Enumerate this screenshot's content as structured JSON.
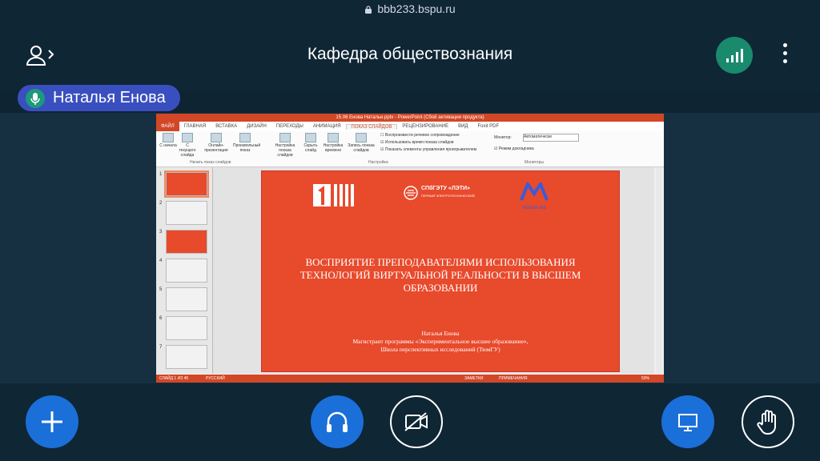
{
  "browser": {
    "url": "bbb233.bspu.ru"
  },
  "header": {
    "title": "Кафедра обществознания"
  },
  "talker": {
    "name": "Наталья Енова"
  },
  "ppt": {
    "window_title": "15.06 Енова Натальи.pptx - PowerPoint (Сбой активации продукта)",
    "tabs": [
      "ФАЙЛ",
      "ГЛАВНАЯ",
      "ВСТАВКА",
      "ДИЗАЙН",
      "ПЕРЕХОДЫ",
      "АНИМАЦИЯ",
      "ПОКАЗ СЛАЙДОВ",
      "РЕЦЕНЗИРОВАНИЕ",
      "ВИД",
      "Foxit PDF"
    ],
    "ribbon": {
      "b1": "С начала",
      "b2": "С текущего слайда",
      "b3": "Онлайн-презентация",
      "b4": "Произвольный показ",
      "b5": "Настройка показа слайдов",
      "b6": "Скрыть слайд",
      "b7": "Настройка времени",
      "b8": "Запись показа слайдов",
      "c1": "Воспроизвести речевое сопровождение",
      "c2": "Использовать время показа слайдов",
      "c3": "Показать элементы управления проигрывателем",
      "monitor_label": "Монитор:",
      "monitor_value": "Автоматически",
      "presenter": "Режим докладчика",
      "g1": "Начать показ слайдов",
      "g2": "Настройка",
      "g3": "Мониторы"
    },
    "thumb_numbers": [
      "1",
      "2",
      "3",
      "4",
      "5",
      "6",
      "7"
    ],
    "slide": {
      "logo_text": "СПбГЭТУ «ЛЭТИ»",
      "logo_sub": "ПЕРВЫЙ ЭЛЕКТРОТЕХНИЧЕСКИЙ",
      "logo3_text": "modum lab",
      "heading_l1": "ВОСПРИЯТИЕ ПРЕПОДАВАТЕЛЯМИ ИСПОЛЬЗОВАНИЯ",
      "heading_l2": "ТЕХНОЛОГИЙ ВИРТУАЛЬНОЙ РЕАЛЬНОСТИ В ВЫСШЕМ",
      "heading_l3": "ОБРАЗОВАНИИ",
      "author": "Наталья Енова",
      "line2": "Магистрант программы «Экспериментальное высшее образование»,",
      "line3": "Школа перспективных исследований (ТюмГУ)"
    },
    "status": {
      "slide": "СЛАЙД 1 ИЗ 45",
      "lang": "РУССКИЙ",
      "notes": "ЗАМЕТКИ",
      "comments": "ПРИМЕЧАНИЯ",
      "zoom": "50%"
    }
  }
}
